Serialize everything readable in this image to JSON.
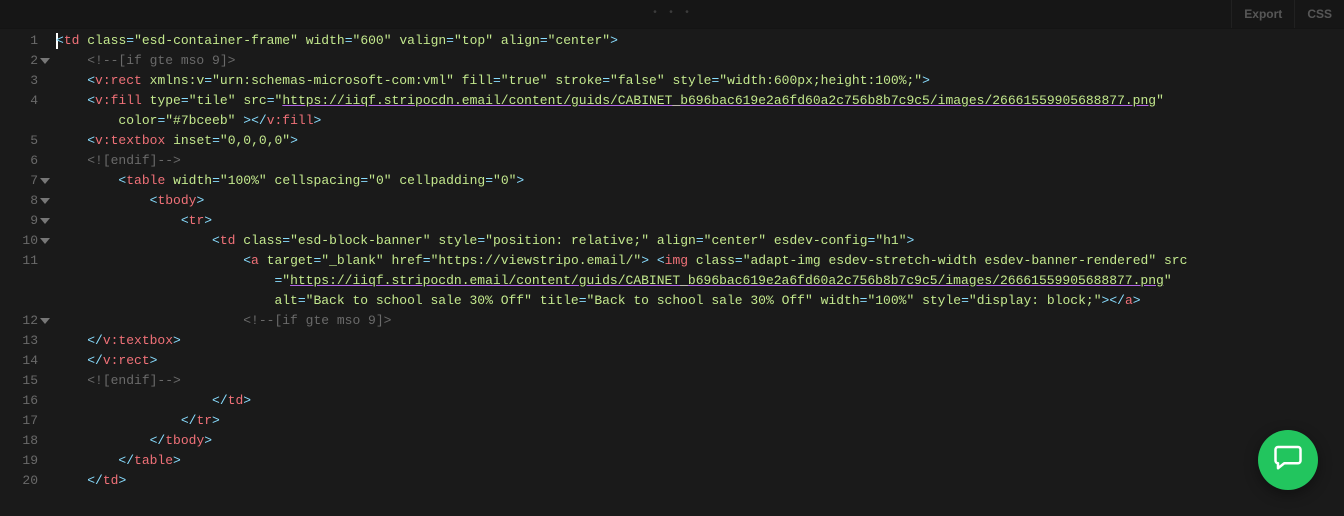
{
  "topbar": {
    "export": "Export",
    "css": "CSS"
  },
  "lines": [
    {
      "n": 1,
      "fold": false,
      "indent": 0,
      "segs": [
        {
          "txt": "<",
          "cls": "p"
        },
        {
          "txt": "td",
          "cls": "t"
        },
        {
          "txt": " ",
          "cls": "w"
        },
        {
          "txt": "class",
          "cls": "a"
        },
        {
          "txt": "=",
          "cls": "p"
        },
        {
          "txt": "\"esd-container-frame\"",
          "cls": "s"
        },
        {
          "txt": " ",
          "cls": "w"
        },
        {
          "txt": "width",
          "cls": "a"
        },
        {
          "txt": "=",
          "cls": "p"
        },
        {
          "txt": "\"600\"",
          "cls": "s"
        },
        {
          "txt": " ",
          "cls": "w"
        },
        {
          "txt": "valign",
          "cls": "a"
        },
        {
          "txt": "=",
          "cls": "p"
        },
        {
          "txt": "\"top\"",
          "cls": "s"
        },
        {
          "txt": " ",
          "cls": "w"
        },
        {
          "txt": "align",
          "cls": "a"
        },
        {
          "txt": "=",
          "cls": "p"
        },
        {
          "txt": "\"center\"",
          "cls": "s"
        },
        {
          "txt": ">",
          "cls": "p"
        }
      ],
      "cursor": true
    },
    {
      "n": 2,
      "fold": true,
      "indent": 1,
      "segs": [
        {
          "txt": "<!--[if gte mso 9]>",
          "cls": "c"
        }
      ]
    },
    {
      "n": 3,
      "fold": false,
      "indent": 1,
      "segs": [
        {
          "txt": "<",
          "cls": "p"
        },
        {
          "txt": "v:rect",
          "cls": "t"
        },
        {
          "txt": " ",
          "cls": "w"
        },
        {
          "txt": "xmlns:v",
          "cls": "a"
        },
        {
          "txt": "=",
          "cls": "p"
        },
        {
          "txt": "\"urn:schemas-microsoft-com:vml\"",
          "cls": "s"
        },
        {
          "txt": " ",
          "cls": "w"
        },
        {
          "txt": "fill",
          "cls": "a"
        },
        {
          "txt": "=",
          "cls": "p"
        },
        {
          "txt": "\"true\"",
          "cls": "s"
        },
        {
          "txt": " ",
          "cls": "w"
        },
        {
          "txt": "stroke",
          "cls": "a"
        },
        {
          "txt": "=",
          "cls": "p"
        },
        {
          "txt": "\"false\"",
          "cls": "s"
        },
        {
          "txt": " ",
          "cls": "w"
        },
        {
          "txt": "style",
          "cls": "a"
        },
        {
          "txt": "=",
          "cls": "p"
        },
        {
          "txt": "\"width:600px;height:100%;\"",
          "cls": "s"
        },
        {
          "txt": ">",
          "cls": "p"
        }
      ]
    },
    {
      "n": 4,
      "fold": false,
      "indent": 1,
      "segs": [
        {
          "txt": "<",
          "cls": "p"
        },
        {
          "txt": "v:fill",
          "cls": "t"
        },
        {
          "txt": " ",
          "cls": "w"
        },
        {
          "txt": "type",
          "cls": "a"
        },
        {
          "txt": "=",
          "cls": "p"
        },
        {
          "txt": "\"tile\"",
          "cls": "s"
        },
        {
          "txt": " ",
          "cls": "w"
        },
        {
          "txt": "src",
          "cls": "a"
        },
        {
          "txt": "=",
          "cls": "p"
        },
        {
          "txt": "\"",
          "cls": "s"
        },
        {
          "txt": "https://iiqf.stripocdn.email/content/guids/CABINET_b696bac619e2a6fd60a2c756b8b7c9c5/images/26661559905688877.png",
          "cls": "url"
        },
        {
          "txt": "\"",
          "cls": "s"
        }
      ]
    },
    {
      "n": "4b",
      "fold": false,
      "indent": 2,
      "segs": [
        {
          "txt": "color",
          "cls": "a"
        },
        {
          "txt": "=",
          "cls": "p"
        },
        {
          "txt": "\"#7bceeb\"",
          "cls": "s"
        },
        {
          "txt": " >",
          "cls": "p"
        },
        {
          "txt": "</",
          "cls": "p"
        },
        {
          "txt": "v:fill",
          "cls": "t"
        },
        {
          "txt": ">",
          "cls": "p"
        }
      ]
    },
    {
      "n": 5,
      "fold": false,
      "indent": 1,
      "segs": [
        {
          "txt": "<",
          "cls": "p"
        },
        {
          "txt": "v:textbox",
          "cls": "t"
        },
        {
          "txt": " ",
          "cls": "w"
        },
        {
          "txt": "inset",
          "cls": "a"
        },
        {
          "txt": "=",
          "cls": "p"
        },
        {
          "txt": "\"0,0,0,0\"",
          "cls": "s"
        },
        {
          "txt": ">",
          "cls": "p"
        }
      ]
    },
    {
      "n": 6,
      "fold": false,
      "indent": 1,
      "segs": [
        {
          "txt": "<![endif]-->",
          "cls": "c"
        }
      ]
    },
    {
      "n": 7,
      "fold": true,
      "indent": 2,
      "segs": [
        {
          "txt": "<",
          "cls": "p"
        },
        {
          "txt": "table",
          "cls": "t"
        },
        {
          "txt": " ",
          "cls": "w"
        },
        {
          "txt": "width",
          "cls": "a"
        },
        {
          "txt": "=",
          "cls": "p"
        },
        {
          "txt": "\"100%\"",
          "cls": "s"
        },
        {
          "txt": " ",
          "cls": "w"
        },
        {
          "txt": "cellspacing",
          "cls": "a"
        },
        {
          "txt": "=",
          "cls": "p"
        },
        {
          "txt": "\"0\"",
          "cls": "s"
        },
        {
          "txt": " ",
          "cls": "w"
        },
        {
          "txt": "cellpadding",
          "cls": "a"
        },
        {
          "txt": "=",
          "cls": "p"
        },
        {
          "txt": "\"0\"",
          "cls": "s"
        },
        {
          "txt": ">",
          "cls": "p"
        }
      ]
    },
    {
      "n": 8,
      "fold": true,
      "indent": 3,
      "segs": [
        {
          "txt": "<",
          "cls": "p"
        },
        {
          "txt": "tbody",
          "cls": "t"
        },
        {
          "txt": ">",
          "cls": "p"
        }
      ]
    },
    {
      "n": 9,
      "fold": true,
      "indent": 4,
      "segs": [
        {
          "txt": "<",
          "cls": "p"
        },
        {
          "txt": "tr",
          "cls": "t"
        },
        {
          "txt": ">",
          "cls": "p"
        }
      ]
    },
    {
      "n": 10,
      "fold": true,
      "indent": 5,
      "segs": [
        {
          "txt": "<",
          "cls": "p"
        },
        {
          "txt": "td",
          "cls": "t"
        },
        {
          "txt": " ",
          "cls": "w"
        },
        {
          "txt": "class",
          "cls": "a"
        },
        {
          "txt": "=",
          "cls": "p"
        },
        {
          "txt": "\"esd-block-banner\"",
          "cls": "s"
        },
        {
          "txt": " ",
          "cls": "w"
        },
        {
          "txt": "style",
          "cls": "a"
        },
        {
          "txt": "=",
          "cls": "p"
        },
        {
          "txt": "\"position: relative;\"",
          "cls": "s"
        },
        {
          "txt": " ",
          "cls": "w"
        },
        {
          "txt": "align",
          "cls": "a"
        },
        {
          "txt": "=",
          "cls": "p"
        },
        {
          "txt": "\"center\"",
          "cls": "s"
        },
        {
          "txt": " ",
          "cls": "w"
        },
        {
          "txt": "esdev-config",
          "cls": "a"
        },
        {
          "txt": "=",
          "cls": "p"
        },
        {
          "txt": "\"h1\"",
          "cls": "s"
        },
        {
          "txt": ">",
          "cls": "p"
        }
      ]
    },
    {
      "n": 11,
      "fold": false,
      "indent": 6,
      "segs": [
        {
          "txt": "<",
          "cls": "p"
        },
        {
          "txt": "a",
          "cls": "t"
        },
        {
          "txt": " ",
          "cls": "w"
        },
        {
          "txt": "target",
          "cls": "a"
        },
        {
          "txt": "=",
          "cls": "p"
        },
        {
          "txt": "\"_blank\"",
          "cls": "s"
        },
        {
          "txt": " ",
          "cls": "w"
        },
        {
          "txt": "href",
          "cls": "a"
        },
        {
          "txt": "=",
          "cls": "p"
        },
        {
          "txt": "\"https://viewstripo.email/\"",
          "cls": "s"
        },
        {
          "txt": ">",
          "cls": "p"
        },
        {
          "txt": " ",
          "cls": "w"
        },
        {
          "txt": "<",
          "cls": "p"
        },
        {
          "txt": "img",
          "cls": "t"
        },
        {
          "txt": " ",
          "cls": "w"
        },
        {
          "txt": "class",
          "cls": "a"
        },
        {
          "txt": "=",
          "cls": "p"
        },
        {
          "txt": "\"adapt-img esdev-stretch-width esdev-banner-rendered\"",
          "cls": "s"
        },
        {
          "txt": " ",
          "cls": "w"
        },
        {
          "txt": "src",
          "cls": "a"
        }
      ]
    },
    {
      "n": "11b",
      "fold": false,
      "indent": 7,
      "segs": [
        {
          "txt": "=",
          "cls": "p"
        },
        {
          "txt": "\"",
          "cls": "s"
        },
        {
          "txt": "https://iiqf.stripocdn.email/content/guids/CABINET_b696bac619e2a6fd60a2c756b8b7c9c5/images/26661559905688877.png",
          "cls": "url"
        },
        {
          "txt": "\"",
          "cls": "s"
        }
      ]
    },
    {
      "n": "11c",
      "fold": false,
      "indent": 7,
      "segs": [
        {
          "txt": "alt",
          "cls": "a"
        },
        {
          "txt": "=",
          "cls": "p"
        },
        {
          "txt": "\"Back to school sale 30% Off\"",
          "cls": "s"
        },
        {
          "txt": " ",
          "cls": "w"
        },
        {
          "txt": "title",
          "cls": "a"
        },
        {
          "txt": "=",
          "cls": "p"
        },
        {
          "txt": "\"Back to school sale 30% Off\"",
          "cls": "s"
        },
        {
          "txt": " ",
          "cls": "w"
        },
        {
          "txt": "width",
          "cls": "a"
        },
        {
          "txt": "=",
          "cls": "p"
        },
        {
          "txt": "\"100%\"",
          "cls": "s"
        },
        {
          "txt": " ",
          "cls": "w"
        },
        {
          "txt": "style",
          "cls": "a"
        },
        {
          "txt": "=",
          "cls": "p"
        },
        {
          "txt": "\"display: block;\"",
          "cls": "s"
        },
        {
          "txt": ">",
          "cls": "p"
        },
        {
          "txt": "</",
          "cls": "p"
        },
        {
          "txt": "a",
          "cls": "t"
        },
        {
          "txt": ">",
          "cls": "p"
        }
      ]
    },
    {
      "n": 12,
      "fold": true,
      "indent": 6,
      "segs": [
        {
          "txt": "<!--[if gte mso 9]>",
          "cls": "c"
        }
      ]
    },
    {
      "n": 13,
      "fold": false,
      "indent": 1,
      "segs": [
        {
          "txt": "</",
          "cls": "p"
        },
        {
          "txt": "v:textbox",
          "cls": "t"
        },
        {
          "txt": ">",
          "cls": "p"
        }
      ]
    },
    {
      "n": 14,
      "fold": false,
      "indent": 1,
      "segs": [
        {
          "txt": "</",
          "cls": "p"
        },
        {
          "txt": "v:rect",
          "cls": "t"
        },
        {
          "txt": ">",
          "cls": "p"
        }
      ]
    },
    {
      "n": 15,
      "fold": false,
      "indent": 1,
      "segs": [
        {
          "txt": "<![endif]-->",
          "cls": "c"
        }
      ]
    },
    {
      "n": 16,
      "fold": false,
      "indent": 5,
      "segs": [
        {
          "txt": "</",
          "cls": "p"
        },
        {
          "txt": "td",
          "cls": "t"
        },
        {
          "txt": ">",
          "cls": "p"
        }
      ]
    },
    {
      "n": 17,
      "fold": false,
      "indent": 4,
      "segs": [
        {
          "txt": "</",
          "cls": "p"
        },
        {
          "txt": "tr",
          "cls": "t"
        },
        {
          "txt": ">",
          "cls": "p"
        }
      ]
    },
    {
      "n": 18,
      "fold": false,
      "indent": 3,
      "segs": [
        {
          "txt": "</",
          "cls": "p"
        },
        {
          "txt": "tbody",
          "cls": "t"
        },
        {
          "txt": ">",
          "cls": "p"
        }
      ]
    },
    {
      "n": 19,
      "fold": false,
      "indent": 2,
      "segs": [
        {
          "txt": "</",
          "cls": "p"
        },
        {
          "txt": "table",
          "cls": "t"
        },
        {
          "txt": ">",
          "cls": "p"
        }
      ]
    },
    {
      "n": 20,
      "fold": false,
      "indent": 1,
      "segs": [
        {
          "txt": "</",
          "cls": "p"
        },
        {
          "txt": "td",
          "cls": "t"
        },
        {
          "txt": ">",
          "cls": "p"
        }
      ]
    }
  ]
}
